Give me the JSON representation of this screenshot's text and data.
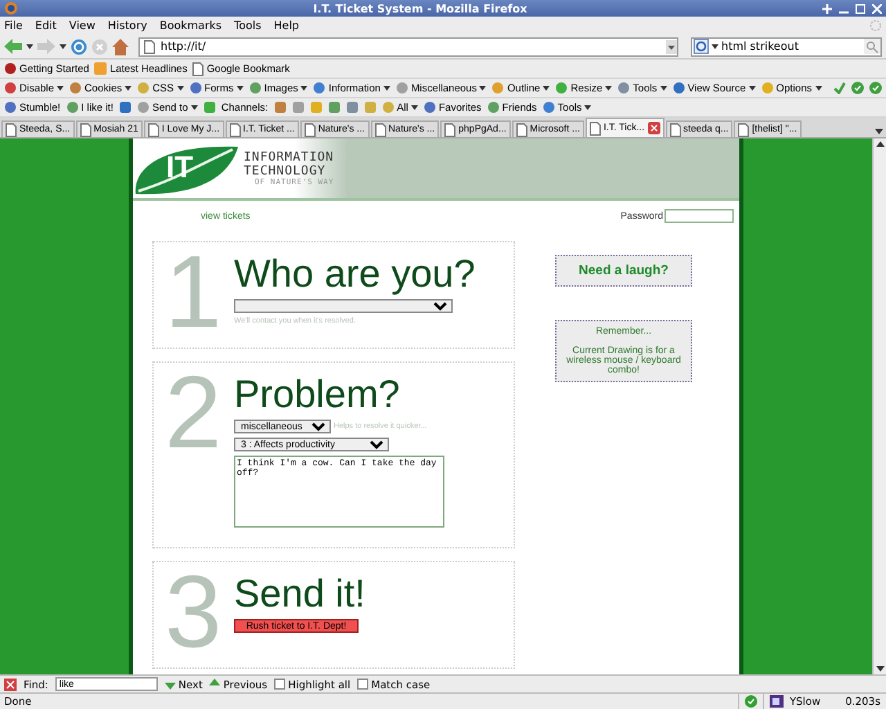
{
  "window": {
    "title": "I.T. Ticket System - Mozilla Firefox"
  },
  "menu": [
    "File",
    "Edit",
    "View",
    "History",
    "Bookmarks",
    "Tools",
    "Help"
  ],
  "navigation": {
    "url": "http://it/",
    "search": "html strikeout"
  },
  "bookmarks": [
    "Getting Started",
    "Latest Headlines",
    "Google Bookmark"
  ],
  "developer_toolbar": [
    {
      "label": "Disable",
      "menu": true
    },
    {
      "label": "Cookies",
      "menu": true
    },
    {
      "label": "CSS",
      "menu": true
    },
    {
      "label": "Forms",
      "menu": true
    },
    {
      "label": "Images",
      "menu": true
    },
    {
      "label": "Information",
      "menu": true
    },
    {
      "label": "Miscellaneous",
      "menu": true
    },
    {
      "label": "Outline",
      "menu": true
    },
    {
      "label": "Resize",
      "menu": true
    },
    {
      "label": "Tools",
      "menu": true
    },
    {
      "label": "View Source",
      "menu": true
    },
    {
      "label": "Options",
      "menu": true
    }
  ],
  "stumble_toolbar": [
    {
      "kind": "button",
      "label": "Stumble!",
      "menu": false
    },
    {
      "kind": "button",
      "label": "I like it!",
      "menu": false
    },
    {
      "kind": "icon"
    },
    {
      "kind": "button",
      "label": "Send to",
      "menu": true
    },
    {
      "kind": "icon"
    },
    {
      "kind": "label",
      "label": "Channels:"
    },
    {
      "kind": "icon"
    },
    {
      "kind": "icon"
    },
    {
      "kind": "icon"
    },
    {
      "kind": "icon"
    },
    {
      "kind": "icon"
    },
    {
      "kind": "icon"
    },
    {
      "kind": "button",
      "label": "All",
      "menu": true
    },
    {
      "kind": "button",
      "label": "Favorites",
      "menu": false
    },
    {
      "kind": "button",
      "label": "Friends",
      "menu": false
    },
    {
      "kind": "button",
      "label": "Tools",
      "menu": true
    }
  ],
  "tabs": [
    {
      "label": "Steeda, S...",
      "selected": false
    },
    {
      "label": "Mosiah 21",
      "selected": false
    },
    {
      "label": "I Love My J...",
      "selected": false
    },
    {
      "label": "I.T. Ticket ...",
      "selected": false
    },
    {
      "label": "Nature's ...",
      "selected": false
    },
    {
      "label": "Nature's ...",
      "selected": false
    },
    {
      "label": "phpPgAd...",
      "selected": false
    },
    {
      "label": "Microsoft ...",
      "selected": false
    },
    {
      "label": "I.T. Tick...",
      "selected": true
    },
    {
      "label": "steeda q...",
      "selected": false
    },
    {
      "label": "[thelist] \"...",
      "selected": false
    }
  ],
  "page": {
    "logo": {
      "mark": "IT",
      "line_1": "INFORMATION",
      "line_2": "TECHNOLOGY",
      "line_3": "OF NATURE'S WAY"
    },
    "nav_link": "view tickets",
    "password_label": "Password",
    "steps": [
      {
        "number": "1",
        "title": "Who are you?",
        "fields": [
          {
            "kind": "select"
          }
        ],
        "hint": "We'll contact you when it's resolved."
      },
      {
        "number": "2",
        "title": "Problem?",
        "fields": [
          {
            "kind": "select",
            "value": "miscellaneous",
            "hint": "Helps to resolve it quicker..."
          },
          {
            "kind": "select",
            "value": "3 : Affects productivity"
          },
          {
            "kind": "textarea",
            "value": "I think I'm a cow. Can I take the day off?"
          }
        ]
      },
      {
        "number": "3",
        "title": "Send it!",
        "fields": [
          {
            "kind": "button",
            "value": "Rush ticket to I.T. Dept!"
          }
        ]
      }
    ],
    "sidebar": [
      {
        "kind": "link",
        "text": "Need a laugh?"
      },
      {
        "kind": "note",
        "title": "Remember...",
        "text": "Current Drawing is for a wireless mouse / keyboard combo!"
      }
    ]
  },
  "find_bar": {
    "label": "Find:",
    "value": "like",
    "next": "Next",
    "previous": "Previous",
    "highlight_all": {
      "label": "Highlight all",
      "checked": false
    },
    "match_case": {
      "label": "Match case",
      "checked": false
    }
  },
  "status_bar": {
    "text": "Done",
    "yslow": "YSlow",
    "time": "0.203s"
  }
}
